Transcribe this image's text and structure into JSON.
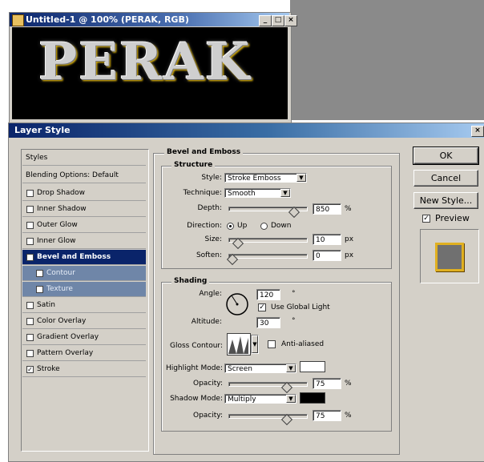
{
  "document_window": {
    "title": "Untitled-1 @ 100% (PERAK, RGB)",
    "canvas_text": "PERAK",
    "buttons": [
      "_",
      "□",
      "×"
    ]
  },
  "dialog": {
    "title": "Layer Style",
    "close": "×"
  },
  "styles_list": {
    "header": "Styles",
    "blending": "Blending Options: Default",
    "items": [
      {
        "label": "Drop Shadow",
        "checked": false
      },
      {
        "label": "Inner Shadow",
        "checked": false
      },
      {
        "label": "Outer Glow",
        "checked": false
      },
      {
        "label": "Inner Glow",
        "checked": false
      },
      {
        "label": "Bevel and Emboss",
        "checked": true,
        "selected": true
      },
      {
        "label": "Contour",
        "checked": false,
        "sub": true
      },
      {
        "label": "Texture",
        "checked": false,
        "sub": true
      },
      {
        "label": "Satin",
        "checked": false
      },
      {
        "label": "Color Overlay",
        "checked": false
      },
      {
        "label": "Gradient Overlay",
        "checked": false
      },
      {
        "label": "Pattern Overlay",
        "checked": false
      },
      {
        "label": "Stroke",
        "checked": true
      }
    ]
  },
  "bevel": {
    "group_title": "Bevel and Emboss",
    "structure_title": "Structure",
    "style_label": "Style:",
    "style_value": "Stroke Emboss",
    "technique_label": "Technique:",
    "technique_value": "Smooth",
    "depth_label": "Depth:",
    "depth_value": "850",
    "depth_unit": "%",
    "direction_label": "Direction:",
    "dir_up": "Up",
    "dir_down": "Down",
    "direction_selected": "Up",
    "size_label": "Size:",
    "size_value": "10",
    "size_unit": "px",
    "soften_label": "Soften:",
    "soften_value": "0",
    "soften_unit": "px"
  },
  "shading": {
    "title": "Shading",
    "angle_label": "Angle:",
    "angle_value": "120",
    "angle_unit": "°",
    "global_light_label": "Use Global Light",
    "global_light_checked": true,
    "altitude_label": "Altitude:",
    "altitude_value": "30",
    "altitude_unit": "°",
    "gloss_label": "Gloss Contour:",
    "anti_aliased_label": "Anti-aliased",
    "anti_aliased_checked": false,
    "highlight_mode_label": "Highlight Mode:",
    "highlight_mode_value": "Screen",
    "highlight_color": "#ffffff",
    "highlight_opacity_label": "Opacity:",
    "highlight_opacity_value": "75",
    "highlight_opacity_unit": "%",
    "shadow_mode_label": "Shadow Mode:",
    "shadow_mode_value": "Multiply",
    "shadow_color": "#000000",
    "shadow_opacity_label": "Opacity:",
    "shadow_opacity_value": "75",
    "shadow_opacity_unit": "%"
  },
  "buttons": {
    "ok": "OK",
    "cancel": "Cancel",
    "new_style": "New Style...",
    "preview_label": "Preview",
    "preview_checked": true
  },
  "levels": {
    "depth_fraction": 0.85,
    "size_fraction": 0.08,
    "soften_fraction": 0.0,
    "highlight_opacity_fraction": 0.75,
    "shadow_opacity_fraction": 0.75
  }
}
